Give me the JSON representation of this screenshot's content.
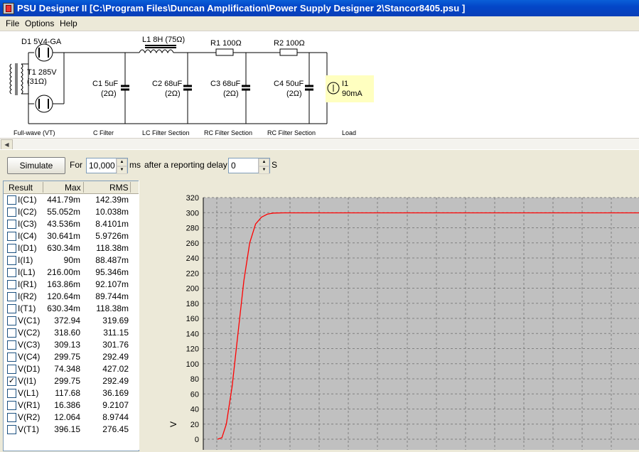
{
  "window": {
    "title": "PSU Designer II  [C:\\Program Files\\Duncan Amplification\\Power Supply Designer 2\\Stancor8405.psu ]"
  },
  "menu": {
    "file": "File",
    "options": "Options",
    "help": "Help"
  },
  "schematic": {
    "rectifier_label": "D1 5V4-GA",
    "transformer_label": "T1 285V",
    "transformer_res": "(31Ω)",
    "c1_label": "C1 5uF",
    "c1_res": "(2Ω)",
    "l1_label": "L1 8H (75Ω)",
    "c2_label": "C2 68uF",
    "c2_res": "(2Ω)",
    "r1_label": "R1 100Ω",
    "c3_label": "C3 68uF",
    "c3_res": "(2Ω)",
    "r2_label": "R2 100Ω",
    "c4_label": "C4 50uF",
    "c4_res": "(2Ω)",
    "load_label": "I1",
    "load_value": "90mA",
    "sections": [
      "Full-wave (VT)",
      "C Filter",
      "LC Filter Section",
      "RC Filter Section",
      "RC Filter Section",
      "Load"
    ]
  },
  "controls": {
    "simulate_label": "Simulate",
    "for_label": "For",
    "duration_value": "10,000",
    "ms_label": "ms",
    "delay_label": "after a reporting delay of",
    "delay_value": "0",
    "s_label": "S"
  },
  "results": {
    "headers": {
      "result": "Result",
      "max": "Max",
      "rms": "RMS"
    },
    "rows": [
      {
        "name": "I(C1)",
        "max": "441.79m",
        "rms": "142.39m",
        "checked": false
      },
      {
        "name": "I(C2)",
        "max": "55.052m",
        "rms": "10.038m",
        "checked": false
      },
      {
        "name": "I(C3)",
        "max": "43.536m",
        "rms": "8.4101m",
        "checked": false
      },
      {
        "name": "I(C4)",
        "max": "30.641m",
        "rms": "5.9726m",
        "checked": false
      },
      {
        "name": "I(D1)",
        "max": "630.34m",
        "rms": "118.38m",
        "checked": false
      },
      {
        "name": "I(I1)",
        "max": "90m",
        "rms": "88.487m",
        "checked": false
      },
      {
        "name": "I(L1)",
        "max": "216.00m",
        "rms": "95.346m",
        "checked": false
      },
      {
        "name": "I(R1)",
        "max": "163.86m",
        "rms": "92.107m",
        "checked": false
      },
      {
        "name": "I(R2)",
        "max": "120.64m",
        "rms": "89.744m",
        "checked": false
      },
      {
        "name": "I(T1)",
        "max": "630.34m",
        "rms": "118.38m",
        "checked": false
      },
      {
        "name": "V(C1)",
        "max": "372.94",
        "rms": "319.69",
        "checked": false
      },
      {
        "name": "V(C2)",
        "max": "318.60",
        "rms": "311.15",
        "checked": false
      },
      {
        "name": "V(C3)",
        "max": "309.13",
        "rms": "301.76",
        "checked": false
      },
      {
        "name": "V(C4)",
        "max": "299.75",
        "rms": "292.49",
        "checked": false
      },
      {
        "name": "V(D1)",
        "max": "74.348",
        "rms": "427.02",
        "checked": false
      },
      {
        "name": "V(I1)",
        "max": "299.75",
        "rms": "292.49",
        "checked": true
      },
      {
        "name": "V(L1)",
        "max": "117.68",
        "rms": "36.169",
        "checked": false
      },
      {
        "name": "V(R1)",
        "max": "16.386",
        "rms": "9.2107",
        "checked": false
      },
      {
        "name": "V(R2)",
        "max": "12.064",
        "rms": "8.9744",
        "checked": false
      },
      {
        "name": "V(T1)",
        "max": "396.15",
        "rms": "276.45",
        "checked": false
      }
    ]
  },
  "chart_data": {
    "type": "line",
    "ylabel": "V",
    "ylim": [
      0,
      320
    ],
    "yticks": [
      0,
      20,
      40,
      60,
      80,
      100,
      120,
      140,
      160,
      180,
      200,
      220,
      240,
      260,
      280,
      300,
      320
    ],
    "grid": true,
    "series": [
      {
        "color": "#ff0000",
        "points": [
          [
            0,
            0
          ],
          [
            0.3,
            2
          ],
          [
            0.6,
            20
          ],
          [
            1.0,
            70
          ],
          [
            1.4,
            140
          ],
          [
            1.8,
            210
          ],
          [
            2.2,
            260
          ],
          [
            2.6,
            285
          ],
          [
            3.0,
            294
          ],
          [
            3.4,
            298
          ],
          [
            3.8,
            299.5
          ],
          [
            4.5,
            299.75
          ],
          [
            40,
            299.75
          ]
        ]
      }
    ],
    "colors": {
      "plot_bg": "#c0c0c0",
      "grid": "#808080",
      "axis": "#000000"
    }
  }
}
